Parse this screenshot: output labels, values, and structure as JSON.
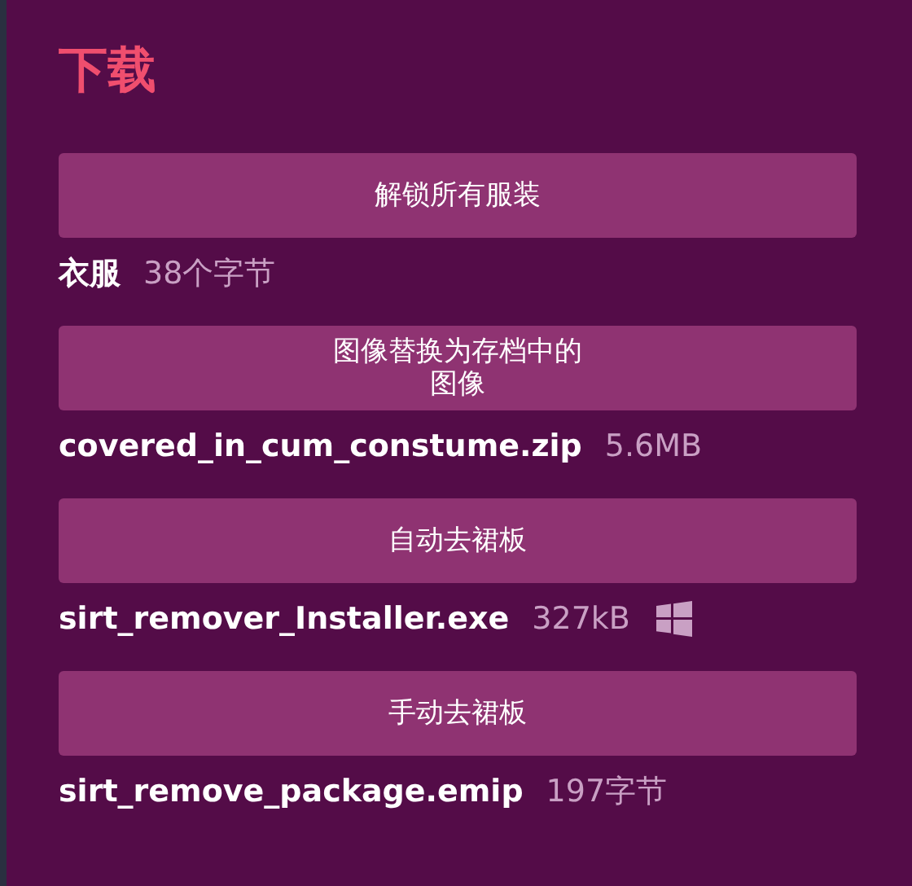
{
  "title": "下载",
  "downloads": [
    {
      "kind": "file",
      "button": "解锁所有服装",
      "file": "衣服",
      "size": "38个字节"
    },
    {
      "kind": "file",
      "button": "图像替换为存档中的图像",
      "file": "covered_in_cum_constume.zip",
      "size": "5.6MB"
    },
    {
      "kind": "windows",
      "button": "自动去裙板",
      "file": "sirt_remover_Installer.exe",
      "size": "327kB"
    },
    {
      "kind": "file",
      "button": "手动去裙板",
      "file": "sirt_remove_package.emip",
      "size": "197字节"
    }
  ]
}
